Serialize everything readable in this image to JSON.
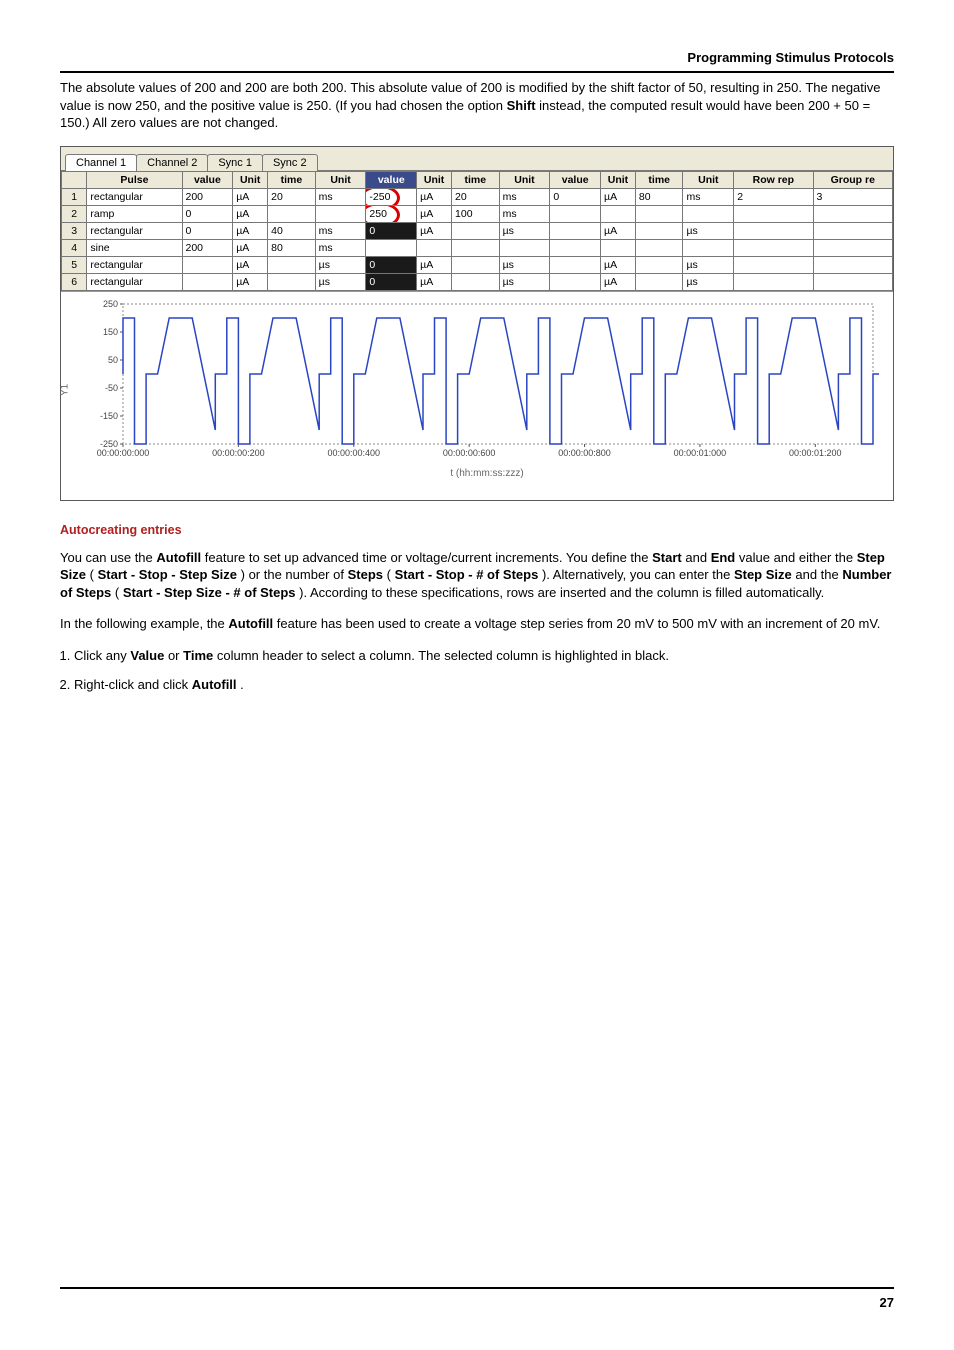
{
  "header": {
    "title": "Programming Stimulus Protocols"
  },
  "intro_para": {
    "t1": "The absolute values of 200 and 200 are both 200. This absolute value of 200 is modified by the shift factor of 50, resulting in 250. The negative value is now 250, and the positive value is 250. (If you had chosen the option ",
    "shift": "Shift",
    "t2": " instead, the computed result would have been 200 + 50 = 150.) All zero values are not changed."
  },
  "app": {
    "tabs": [
      "Channel 1",
      "Channel 2",
      "Sync 1",
      "Sync 2"
    ],
    "active_tab": 0,
    "headers": [
      "",
      "Pulse",
      "value",
      "Unit",
      "time",
      "Unit",
      "value",
      "Unit",
      "time",
      "Unit",
      "value",
      "Unit",
      "time",
      "Unit",
      "Row rep",
      "Group re"
    ],
    "active_header_index": 6,
    "rows": [
      {
        "n": "1",
        "cells": [
          "rectangular",
          "200",
          "µA",
          "20",
          "ms",
          "-250",
          "µA",
          "20",
          "ms",
          "0",
          "µA",
          "80",
          "ms",
          "2",
          "3"
        ],
        "sel": false
      },
      {
        "n": "2",
        "cells": [
          "ramp",
          "0",
          "µA",
          "",
          "",
          "250",
          "µA",
          "100",
          "ms",
          "",
          "",
          "",
          "",
          "",
          ""
        ],
        "sel": false
      },
      {
        "n": "3",
        "cells": [
          "rectangular",
          "0",
          "µA",
          "40",
          "ms",
          "0",
          "µA",
          "",
          "µs",
          "",
          "µA",
          "",
          "µs",
          "",
          ""
        ],
        "sel": true
      },
      {
        "n": "4",
        "cells": [
          "sine",
          "200",
          "µA",
          "80",
          "ms",
          "",
          "",
          "",
          "",
          "",
          "",
          "",
          "",
          "",
          ""
        ],
        "sel": false
      },
      {
        "n": "5",
        "cells": [
          "rectangular",
          "",
          "µA",
          "",
          "µs",
          "0",
          "µA",
          "",
          "µs",
          "",
          "µA",
          "",
          "µs",
          "",
          ""
        ],
        "sel": true
      },
      {
        "n": "6",
        "cells": [
          "rectangular",
          "",
          "µA",
          "",
          "µs",
          "0",
          "µA",
          "",
          "µs",
          "",
          "µA",
          "",
          "µs",
          "",
          ""
        ],
        "sel": true
      }
    ],
    "circled_cells": [
      {
        "row": 0,
        "col": 5
      },
      {
        "row": 1,
        "col": 5
      }
    ]
  },
  "chart_data": {
    "type": "line",
    "title": "",
    "xlabel": "t (hh:mm:ss:zzz)",
    "ylabel": "Y1",
    "xlim_ms": [
      0,
      1300
    ],
    "ylim": [
      -250,
      250
    ],
    "yticks": [
      -250,
      -150,
      -50,
      50,
      150,
      250
    ],
    "xticks_ms": [
      0,
      200,
      400,
      600,
      800,
      1000,
      1200
    ],
    "xtick_labels": [
      "00:00:00:000",
      "00:00:00:200",
      "00:00:00:400",
      "00:00:00:600",
      "00:00:00:800",
      "00:00:01:000",
      "00:00:01:200"
    ],
    "period_ms": 180,
    "cycles": 8,
    "series": [
      {
        "name": "stimulus",
        "color": "#2a45c4",
        "template_points": [
          [
            0,
            0
          ],
          [
            0,
            200
          ],
          [
            20,
            200
          ],
          [
            20,
            -250
          ],
          [
            40,
            -250
          ],
          [
            40,
            0
          ],
          [
            60,
            0
          ],
          [
            60,
            0
          ],
          [
            80,
            200
          ],
          [
            120,
            200
          ],
          [
            160,
            -200
          ],
          [
            160,
            0
          ],
          [
            180,
            0
          ]
        ]
      }
    ]
  },
  "autocreate": {
    "heading": "Autocreating entries",
    "p1": {
      "a": "You can use the ",
      "autofill": "Autofill",
      "b": " feature to set up advanced time or voltage/current increments. You define the ",
      "start": "Start",
      "c": " and ",
      "end": "End",
      "d": " value and either the ",
      "stepsize": "Step Size",
      "e": " (",
      "sss": "Start - Stop - Step Size",
      "f": ") or the number of ",
      "steps": "Steps",
      "g": " (",
      "ssn": "Start - Stop - # of Steps",
      "h": "). Alternatively, you can enter the ",
      "stepsize2": "Step Size",
      "i": " and the ",
      "numsteps": "Number of Steps",
      "j": " (",
      "sssn": "Start - Step Size - # of Steps",
      "k": "). According to these specifications, rows are inserted and the column is filled automatically."
    },
    "p2": {
      "a": "In the following example, the ",
      "autofill": "Autofill",
      "b": " feature has been used to create a voltage step series from 20 mV to 500 mV with an increment of 20 mV."
    },
    "step1": {
      "a": "Click any ",
      "value": "Value",
      "b": " or ",
      "time": "Time",
      "c": " column header to select a column. The selected column is highlighted in black."
    },
    "step2": {
      "a": "Right-click and click ",
      "autofill": "Autofill",
      "b": "."
    }
  },
  "page_number": "27"
}
